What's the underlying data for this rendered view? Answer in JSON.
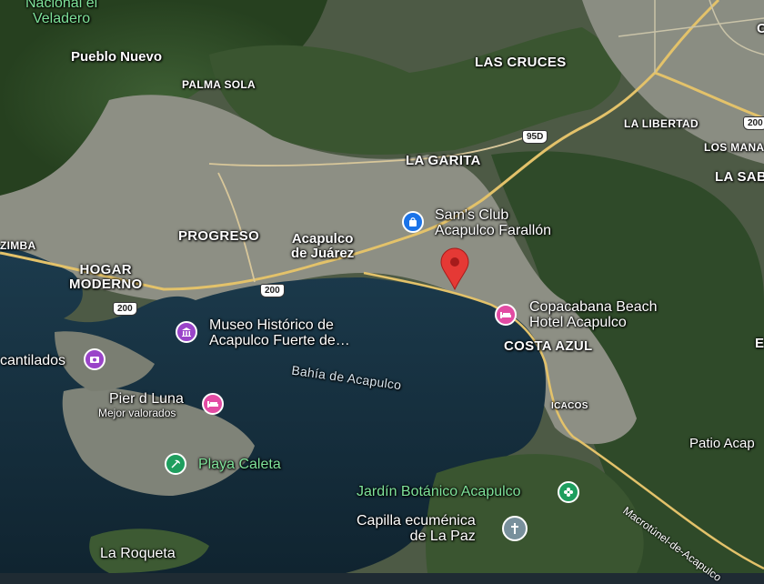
{
  "map": {
    "areas": {
      "veladero": "Nacional el\nVeladero",
      "pueblo_nuevo": "Pueblo Nuevo",
      "palma_sola": "PALMA SOLA",
      "las_cruces": "LAS CRUCES",
      "la_libertad": "LA LIBERTAD",
      "los_manantiales": "LOS MANA",
      "la_sabana": "LA SAB",
      "la_garita": "LA GARITA",
      "progreso": "PROGRESO",
      "acapulco_juarez": "Acapulco\nde Juárez",
      "hogar_moderno": "HOGAR\nMODERNO",
      "zimba": "ZIMBA",
      "costa_azul": "COSTA AZUL",
      "icacos": "ICACOS",
      "patio": "Patio Acap",
      "la_roqueta": "La Roqueta",
      "edge_e": "E",
      "edge_c": "C"
    },
    "pois": {
      "sams_club": "Sam's Club\nAcapulco Farallón",
      "copacabana": "Copacabana Beach\nHotel Acapulco",
      "museo": "Museo Histórico de\nAcapulco Fuerte de…",
      "acantilados": "cantilados",
      "pier_luna": "Pier d Luna",
      "pier_luna_sub": "Mejor valorados",
      "playa_caleta": "Playa Caleta",
      "jardin": "Jardín Botánico Acapulco",
      "capilla": "Capilla ecuménica\nde La Paz"
    },
    "water": {
      "bahia": "Bahía de Acapulco"
    },
    "roads": {
      "r200_a": "200",
      "r200_b": "200",
      "r95d": "95D",
      "r200_c": "200",
      "macro": "Macrotúnel-de-Acapulco"
    },
    "colors": {
      "sea": "#16303f",
      "land_dark": "#2e4a2a",
      "urban": "#8a8c80",
      "road": "#e3c26a",
      "shopping_pin": "#1a73e8",
      "lodging_pin": "#e24ba3",
      "museum_pin": "#9a44c9",
      "park_pin": "#1e9e5e",
      "worship_pin": "#78909c",
      "marker": "#e53935"
    }
  }
}
